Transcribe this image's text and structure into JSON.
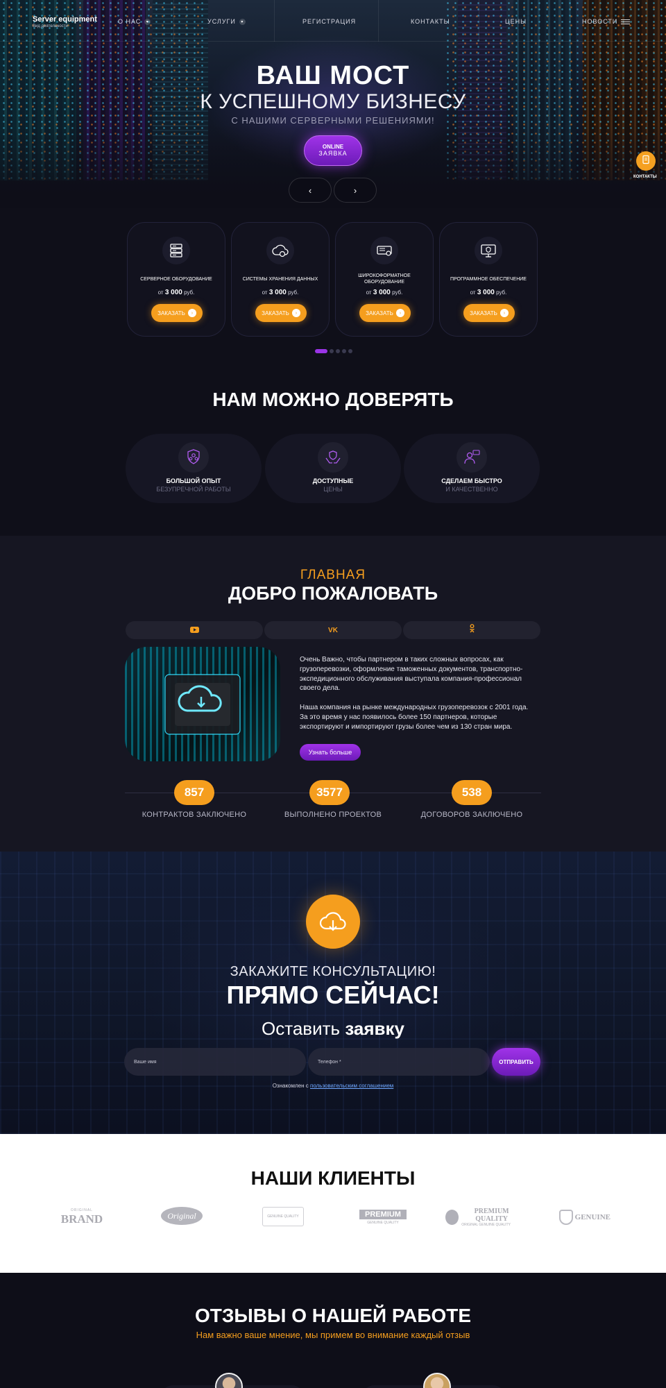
{
  "header": {
    "brand_title": "Server equipment",
    "brand_subtitle": "Вид деятельности",
    "nav": [
      {
        "label": "О НАС",
        "has_dropdown": true
      },
      {
        "label": "УСЛУГИ",
        "has_dropdown": true
      },
      {
        "label": "РЕГИСТРАЦИЯ",
        "has_dropdown": false
      },
      {
        "label": "КОНТАКТЫ",
        "has_dropdown": false
      },
      {
        "label": "ЦЕНЫ",
        "has_dropdown": false
      },
      {
        "label": "НОВОСТИ",
        "has_dropdown": false
      }
    ]
  },
  "hero": {
    "title": "ВАШ МОСТ",
    "subtitle": "К УСПЕШНОМУ БИЗНЕСУ",
    "tagline": "С НАШИМИ СЕРВЕРНЫМИ РЕШЕНИЯМИ!",
    "cta_line1": "ONLINE",
    "cta_line2": "ЗАЯВКА",
    "prev_glyph": "‹",
    "next_glyph": "›"
  },
  "contacts_float": {
    "label": "КОНТАКТЫ",
    "icon": "phone-book-icon"
  },
  "services": {
    "price_prefix": "от",
    "currency": "руб.",
    "button_label": "ЗАКАЗАТЬ",
    "items": [
      {
        "title": "СЕРВЕРНОЕ ОБОРУДОВАНИЕ",
        "price": "3 000",
        "icon": "server-icon"
      },
      {
        "title": "СИСТЕМЫ ХРАНЕНИЯ ДАННЫХ",
        "price": "3 000",
        "icon": "cloud-storage-icon"
      },
      {
        "title": "ШИРОКОФОРМАТНОЕ ОБОРУДОВАНИЕ",
        "price": "3 000",
        "icon": "printer-icon"
      },
      {
        "title": "ПРОГРАММНОЕ ОБЕСПЕЧЕНИЕ",
        "price": "3 000",
        "icon": "software-icon"
      }
    ],
    "pager": {
      "pages": 5,
      "active": 1
    }
  },
  "trust": {
    "title": "НАМ МОЖНО ДОВЕРЯТЬ",
    "items": [
      {
        "title": "БОЛЬШОЙ ОПЫТ",
        "subtitle": "БЕЗУПРЕЧНОЙ РАБОТЫ",
        "icon": "team-icon"
      },
      {
        "title": "ДОСТУПНЫЕ",
        "subtitle": "ЦЕНЫ",
        "icon": "hands-shield-icon"
      },
      {
        "title": "СДЕЛАЕМ БЫСТРО",
        "subtitle": "И КАЧЕСТВЕННО",
        "icon": "worker-icon"
      }
    ]
  },
  "welcome": {
    "eyebrow": "ГЛАВНАЯ",
    "title": "ДОБРО ПОЖАЛОВАТЬ",
    "socials": [
      {
        "name": "youtube",
        "icon": "youtube-icon"
      },
      {
        "name": "vk",
        "label": "VK",
        "icon": "vk-icon"
      },
      {
        "name": "odnoklassniki",
        "icon": "ok-icon"
      }
    ],
    "paragraph1": "Очень Важно, чтобы партнером в таких сложных вопросах, как грузоперевозки, оформление таможенных документов, транспортно-экспедиционного обслуживания выступала компания-профессионал своего дела.",
    "paragraph2": "Наша компания на рынке международных грузоперевозок с 2001 года. За это время у нас появилось более 150 партнеров, которые экспортируют и импортируют грузы более чем из 130 стран мира.",
    "more_button": "Узнать больше",
    "stats": [
      {
        "value": "857",
        "label": "КОНТРАКТОВ ЗАКЛЮЧЕНО"
      },
      {
        "value": "3577",
        "label": "ВЫПОЛНЕНО ПРОЕКТОВ"
      },
      {
        "value": "538",
        "label": "ДОГОВОРОВ ЗАКЛЮЧЕНО"
      }
    ]
  },
  "cta": {
    "icon": "cloud-download-icon",
    "line1": "ЗАКАЖИТЕ КОНСУЛЬТАЦИЮ!",
    "line2": "ПРЯМО СЕЙЧАС!",
    "line3_regular": "Оставить",
    "line3_bold": "заявку",
    "name_placeholder": "Ваше имя",
    "phone_placeholder": "Телефон *",
    "submit_label": "ОТПРАВИТЬ",
    "agree_text": "Ознакомлен с",
    "agree_link": "пользовательским соглашением"
  },
  "clients": {
    "title": "НАШИ КЛИЕНТЫ",
    "logos": [
      {
        "line1": "ORIGINAL",
        "line2": "BRAND"
      },
      {
        "line1": "Original",
        "line2": ""
      },
      {
        "line1": "GENUINE QUALITY",
        "line2": ""
      },
      {
        "line1": "PREMIUM",
        "line2": "GENUINE QUALITY"
      },
      {
        "line1": "PREMIUM QUALITY",
        "line2": "ORIGINAL GENUINE QUALITY"
      },
      {
        "line1": "GENUINE",
        "line2": ""
      }
    ]
  },
  "reviews": {
    "title": "ОТЗЫВЫ О НАШЕЙ РАБОТЕ",
    "subtitle": "Нам важно ваше мнение, мы примем во внимание каждый отзыв"
  },
  "colors": {
    "accent_orange": "#f59e1e",
    "accent_purple": "#9a34e6",
    "background_dark": "#0f0f19",
    "section_dark": "#161622"
  }
}
